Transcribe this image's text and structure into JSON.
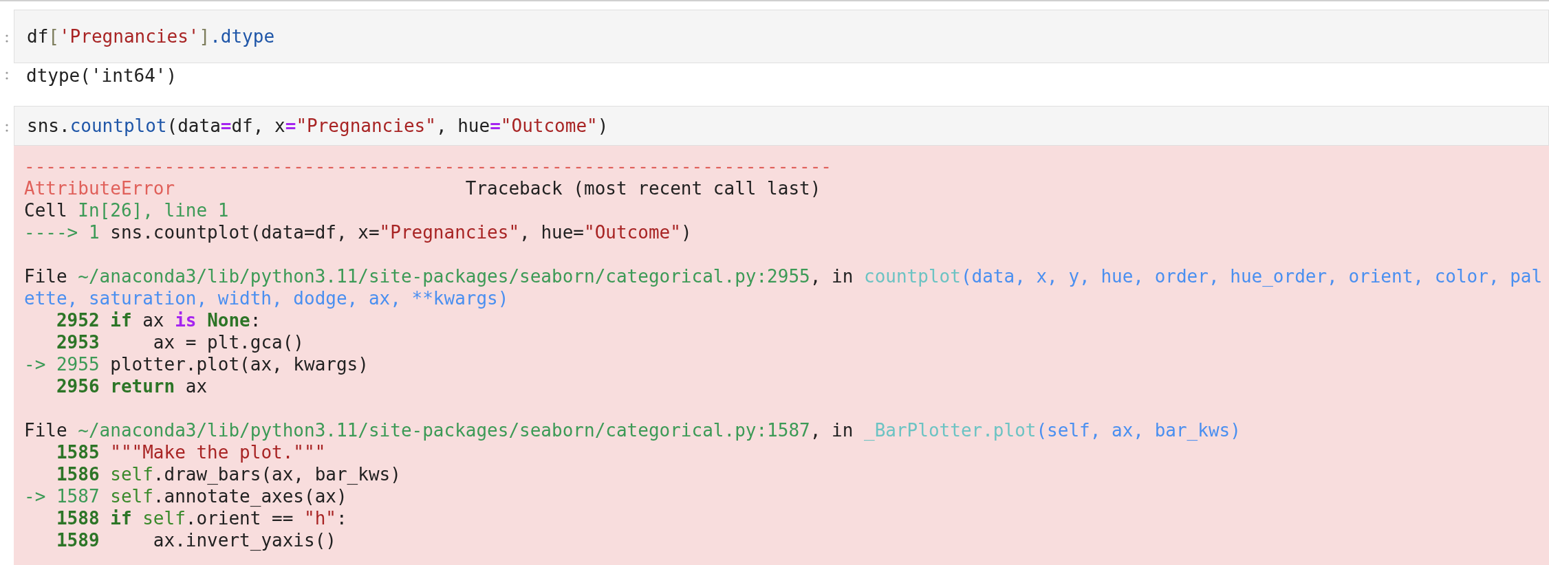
{
  "cells": [
    {
      "kind": "input",
      "lines": [
        [
          {
            "text": "df",
            "kind": "plain"
          },
          {
            "text": "[",
            "kind": "punct"
          },
          {
            "text": "'Pregnancies'",
            "kind": "str"
          },
          {
            "text": "]",
            "kind": "punct"
          },
          {
            "text": ".dtype",
            "kind": "attr"
          }
        ]
      ]
    },
    {
      "kind": "output",
      "lines": [
        [
          {
            "text": "dtype('int64')",
            "kind": "plain"
          }
        ]
      ]
    },
    {
      "kind": "input",
      "lines": [
        [
          {
            "text": "sns.",
            "kind": "plain"
          },
          {
            "text": "countplot",
            "kind": "attr"
          },
          {
            "text": "(data",
            "kind": "plain"
          },
          {
            "text": "=",
            "kind": "op"
          },
          {
            "text": "df, x",
            "kind": "plain"
          },
          {
            "text": "=",
            "kind": "op"
          },
          {
            "text": "\"Pregnancies\"",
            "kind": "str"
          },
          {
            "text": ", hue",
            "kind": "plain"
          },
          {
            "text": "=",
            "kind": "op"
          },
          {
            "text": "\"Outcome\"",
            "kind": "str"
          },
          {
            "text": ")",
            "kind": "plain"
          }
        ]
      ]
    },
    {
      "kind": "error",
      "lines": [
        [
          {
            "text": "---------------------------------------------------------------------------",
            "kind": "err"
          }
        ],
        [
          {
            "text": "AttributeError",
            "kind": "err"
          },
          {
            "text": "                           Traceback (most recent call last)",
            "kind": "plain"
          }
        ],
        [
          {
            "text": "Cell ",
            "kind": "plain"
          },
          {
            "text": "In[26], line 1",
            "kind": "tbgreen"
          }
        ],
        [
          {
            "text": "----> 1",
            "kind": "tbgreen"
          },
          {
            "text": " sns.countplot(data=df, x=",
            "kind": "plain"
          },
          {
            "text": "\"Pregnancies\"",
            "kind": "str"
          },
          {
            "text": ", hue=",
            "kind": "plain"
          },
          {
            "text": "\"Outcome\"",
            "kind": "str"
          },
          {
            "text": ")",
            "kind": "plain"
          }
        ],
        {
          "blank_before": true,
          "tokens": [
            {
              "text": "File ",
              "kind": "plain"
            },
            {
              "text": "~/anaconda3/lib/python3.11/site-packages/seaborn/categorical.py:2955",
              "kind": "tbgreen"
            },
            {
              "text": ", in ",
              "kind": "plain"
            },
            {
              "text": "countplot",
              "kind": "tbcyan"
            },
            {
              "text": "(data, x, y, hue, order, hue_order, orient, color, pal",
              "kind": "tbblue"
            }
          ]
        },
        [
          {
            "text": "ette, saturation, width, dodge, ax, **kwargs)",
            "kind": "tbblue"
          }
        ],
        [
          {
            "text": "   2952",
            "kind": "lineno"
          },
          {
            "text": " if",
            "kind": "kw"
          },
          {
            "text": " ax ",
            "kind": "plain"
          },
          {
            "text": "is",
            "kind": "kwop"
          },
          {
            "text": " None",
            "kind": "kw"
          },
          {
            "text": ":",
            "kind": "plain"
          }
        ],
        [
          {
            "text": "   2953",
            "kind": "lineno"
          },
          {
            "text": "     ax = plt.gca()",
            "kind": "plain"
          }
        ],
        [
          {
            "text": "-> 2955",
            "kind": "tbgreen"
          },
          {
            "text": " plotter.plot(ax, kwargs)",
            "kind": "plain"
          }
        ],
        [
          {
            "text": "   2956",
            "kind": "lineno"
          },
          {
            "text": " return",
            "kind": "kw"
          },
          {
            "text": " ax",
            "kind": "plain"
          }
        ],
        {
          "blank_before": true,
          "tokens": [
            {
              "text": "File ",
              "kind": "plain"
            },
            {
              "text": "~/anaconda3/lib/python3.11/site-packages/seaborn/categorical.py:1587",
              "kind": "tbgreen"
            },
            {
              "text": ", in ",
              "kind": "plain"
            },
            {
              "text": "_BarPlotter.plot",
              "kind": "tbcyan"
            },
            {
              "text": "(self, ax, bar_kws)",
              "kind": "tbblue"
            }
          ]
        },
        [
          {
            "text": "   1585",
            "kind": "lineno"
          },
          {
            "text": " \"\"\"Make the plot.\"\"\"",
            "kind": "str"
          }
        ],
        [
          {
            "text": "   1586",
            "kind": "lineno"
          },
          {
            "text": " self",
            "kind": "self"
          },
          {
            "text": ".draw_bars(ax, bar_kws)",
            "kind": "plain"
          }
        ],
        [
          {
            "text": "-> 1587",
            "kind": "tbgreen"
          },
          {
            "text": " self",
            "kind": "self"
          },
          {
            "text": ".annotate_axes(ax)",
            "kind": "plain"
          }
        ],
        [
          {
            "text": "   1588",
            "kind": "lineno"
          },
          {
            "text": " if",
            "kind": "kw"
          },
          {
            "text": " self",
            "kind": "self"
          },
          {
            "text": ".orient == ",
            "kind": "plain"
          },
          {
            "text": "\"h\"",
            "kind": "str"
          },
          {
            "text": ":",
            "kind": "plain"
          }
        ],
        [
          {
            "text": "   1589",
            "kind": "lineno"
          },
          {
            "text": "     ax.invert_yaxis()",
            "kind": "plain"
          }
        ]
      ]
    }
  ]
}
